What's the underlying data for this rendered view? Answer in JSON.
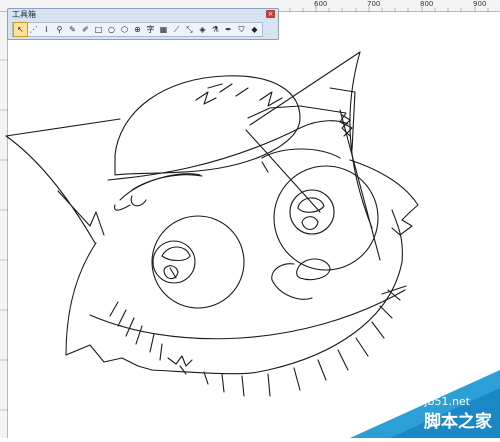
{
  "ruler": {
    "labels": [
      "600",
      "700",
      "800",
      "900"
    ]
  },
  "toolbox": {
    "title": "工具箱",
    "close_glyph": "×",
    "tools": [
      {
        "name": "pick-tool",
        "glyph": "↖"
      },
      {
        "name": "shape-tool",
        "glyph": "⋰"
      },
      {
        "name": "smart-fill-tool",
        "glyph": "⌇"
      },
      {
        "name": "zoom-tool",
        "glyph": "⚲"
      },
      {
        "name": "freehand-tool",
        "glyph": "✎"
      },
      {
        "name": "smart-drawing-tool",
        "glyph": "✐"
      },
      {
        "name": "rectangle-tool",
        "glyph": "□"
      },
      {
        "name": "ellipse-tool",
        "glyph": "○"
      },
      {
        "name": "polygon-tool",
        "glyph": "⬡"
      },
      {
        "name": "basic-shapes-tool",
        "glyph": "⊕"
      },
      {
        "name": "text-tool",
        "glyph": "字"
      },
      {
        "name": "table-tool",
        "glyph": "▦"
      },
      {
        "name": "dimension-tool",
        "glyph": "⟋"
      },
      {
        "name": "connector-tool",
        "glyph": "⤡"
      },
      {
        "name": "blend-tool",
        "glyph": "◈"
      },
      {
        "name": "eyedropper-tool",
        "glyph": "⚗"
      },
      {
        "name": "outline-tool",
        "glyph": "✒"
      },
      {
        "name": "fill-tool",
        "glyph": "⛉"
      },
      {
        "name": "interactive-fill-tool",
        "glyph": "◆"
      }
    ]
  },
  "watermark": {
    "url": "jb51.net",
    "name": "脚本之家"
  },
  "colors": {
    "toolbox_bg": "#d7e3f1",
    "watermark": "#2c9fd7",
    "line": "#1a1a1a"
  }
}
